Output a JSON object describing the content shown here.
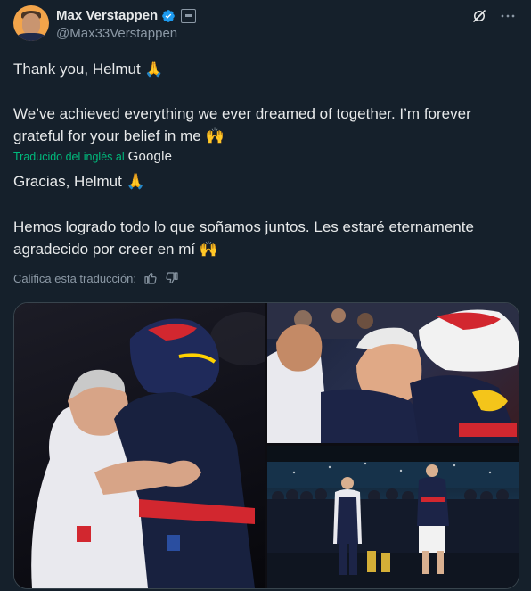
{
  "author": {
    "name": "Max Verstappen",
    "handle": "@Max33Verstappen"
  },
  "tweet": {
    "original_line1": "Thank you, Helmut 🙏",
    "original_line2": "We’ve achieved everything we ever dreamed of together. I’m forever",
    "original_line3": "grateful for your belief in me 🙌",
    "translated_label": "Traducido del inglés al",
    "translator_brand": "Google",
    "translated_line1": "Gracias, Helmut 🙏",
    "translated_line2": "Hemos logrado todo lo que soñamos juntos. Les estaré eternamente",
    "translated_line3": "agradecido por creer en mí 🙌"
  },
  "rating": {
    "label": "Califica esta traducción:"
  },
  "icons": {
    "verified": "verified-badge-icon",
    "affiliate": "affiliate-badge-icon",
    "grok": "grok-icon",
    "more": "more-icon",
    "thumbs_up": "thumbs-up-icon",
    "thumbs_down": "thumbs-down-icon"
  },
  "colors": {
    "background": "#15202b",
    "text": "#e7e9ea",
    "secondary": "#8b98a5",
    "translated_green": "#00ba7c",
    "verified_blue": "#1d9bf0"
  },
  "media": {
    "count": 3
  }
}
